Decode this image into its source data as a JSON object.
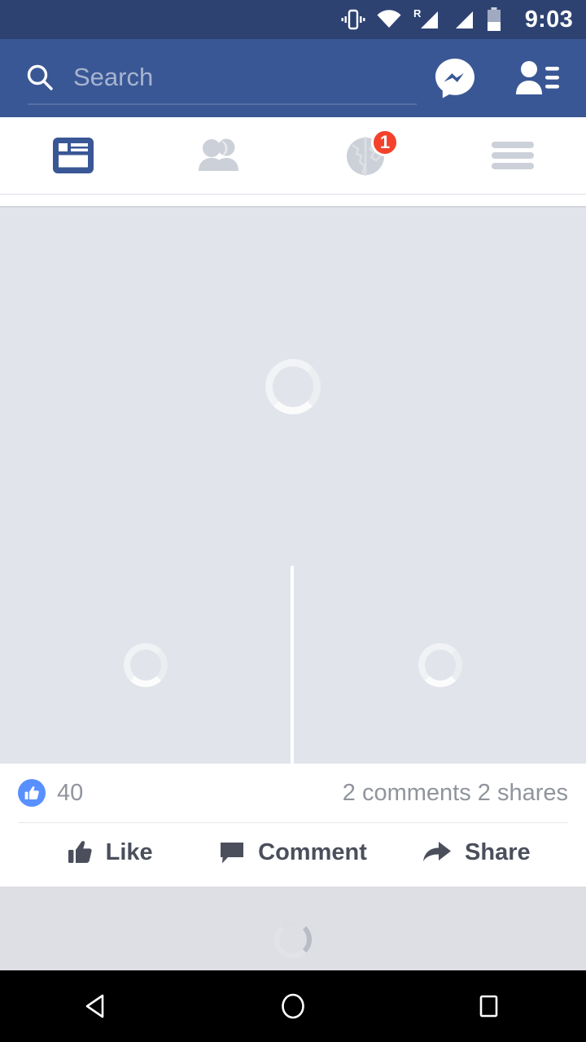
{
  "status_bar": {
    "time": "9:03",
    "roaming_label": "R",
    "icons": [
      "vibrate-icon",
      "wifi-icon",
      "signal-roaming-icon",
      "signal-icon",
      "battery-icon"
    ],
    "background_color": "#2e4272"
  },
  "header": {
    "background_color": "#3a5795",
    "search": {
      "placeholder": "Search",
      "value": "",
      "icon": "search-icon"
    },
    "messenger_icon": "messenger-icon",
    "friend_requests_icon": "friend-requests-icon"
  },
  "tabs": [
    {
      "name": "news-feed",
      "icon": "news-feed-icon",
      "label": "News Feed",
      "active": true,
      "badge": ""
    },
    {
      "name": "friends",
      "icon": "friends-icon",
      "label": "Friends",
      "active": false,
      "badge": ""
    },
    {
      "name": "notifications",
      "icon": "globe-icon",
      "label": "Notifications",
      "active": false,
      "badge": "1"
    },
    {
      "name": "menu",
      "icon": "hamburger-menu-icon",
      "label": "Menu",
      "active": false,
      "badge": ""
    }
  ],
  "accent_colors": {
    "facebook_blue": "#3a5795",
    "badge_red": "#f4412c",
    "like_blue": "#5890ff",
    "placeholder_gray": "#e1e4eb"
  },
  "post": {
    "truncated_text": "",
    "media": {
      "loading": true,
      "big_tile_status": "loading",
      "small_tiles": [
        "loading",
        "loading"
      ]
    },
    "engagement": {
      "like_badge_icon": "thumbs-up-badge-icon",
      "likes_count": "40",
      "comments_shares": "2 comments 2 shares"
    },
    "actions": [
      {
        "name": "like",
        "icon": "thumbs-up-icon",
        "label": "Like"
      },
      {
        "name": "comment",
        "icon": "comment-bubble-icon",
        "label": "Comment"
      },
      {
        "name": "share",
        "icon": "share-arrow-icon",
        "label": "Share"
      }
    ]
  },
  "next_post": {
    "status": "loading"
  },
  "android_nav": [
    {
      "name": "back",
      "icon": "back-triangle-icon"
    },
    {
      "name": "home",
      "icon": "home-circle-icon"
    },
    {
      "name": "recents",
      "icon": "recents-square-icon"
    }
  ]
}
